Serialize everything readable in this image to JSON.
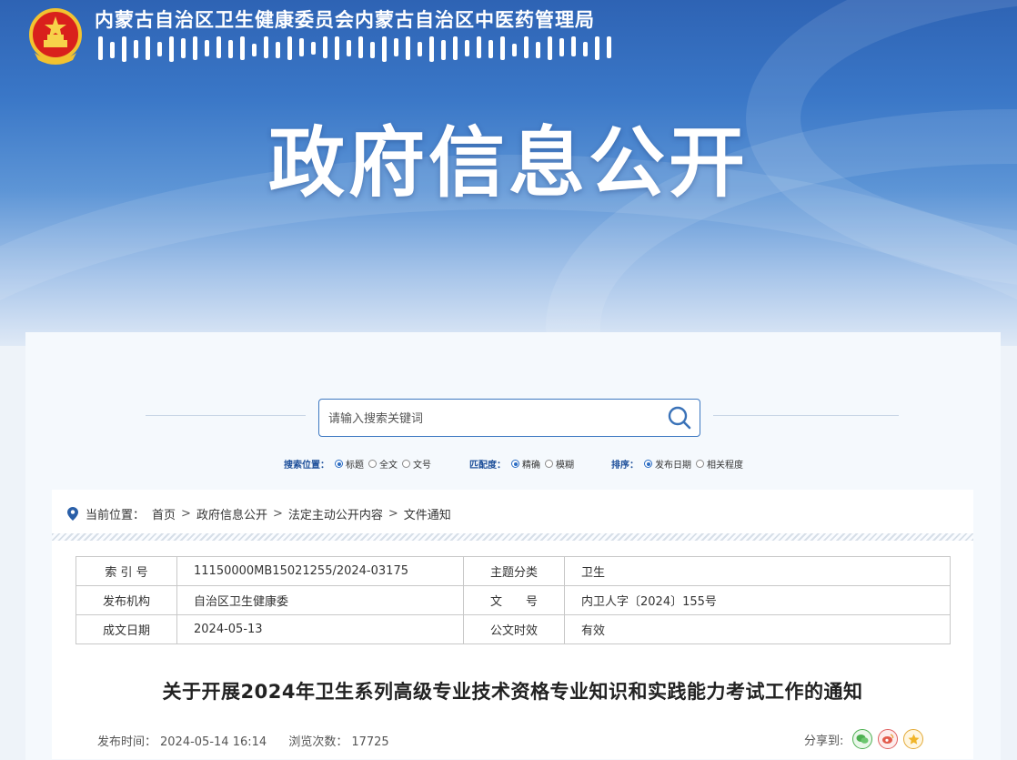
{
  "banner": {
    "org1": "内蒙古自治区卫生健康委员会",
    "org2": "内蒙古自治区中医药管理局",
    "headline": "政府信息公开"
  },
  "search": {
    "placeholder": "请输入搜索关键词",
    "groups": [
      {
        "label": "搜索位置：",
        "options": [
          "标题",
          "全文",
          "文号"
        ],
        "selected": "标题"
      },
      {
        "label": "匹配度：",
        "options": [
          "精确",
          "模糊"
        ],
        "selected": "精确"
      },
      {
        "label": "排序：",
        "options": [
          "发布日期",
          "相关程度"
        ],
        "selected": "发布日期"
      }
    ]
  },
  "breadcrumb": {
    "here": "当前位置：",
    "items": [
      "首页",
      "政府信息公开",
      "法定主动公开内容",
      "文件通知"
    ]
  },
  "meta": {
    "index_label": "索 引 号",
    "index_value": "11150000MB15021255/2024-03175",
    "topic_label": "主题分类",
    "topic_value": "卫生",
    "org_label": "发布机构",
    "org_value": "自治区卫生健康委",
    "docno_label": "文　　号",
    "docno_value": "内卫人字〔2024〕155号",
    "date_label": "成文日期",
    "date_value": "2024-05-13",
    "valid_label": "公文时效",
    "valid_value": "有效"
  },
  "article": {
    "title": "关于开展2024年卫生系列高级专业技术资格专业知识和实践能力考试工作的通知",
    "publish_label": "发布时间：",
    "publish_value": "2024-05-14 16:14",
    "views_label": "浏览次数：",
    "views_value": "17725",
    "share_label": "分享到:"
  },
  "colors": {
    "accent": "#2a6cc3",
    "banner": "#3a77c7"
  },
  "icons": [
    "national-emblem-icon",
    "search-icon",
    "location-pin-icon",
    "wechat-icon",
    "weibo-icon",
    "favorite-icon"
  ]
}
